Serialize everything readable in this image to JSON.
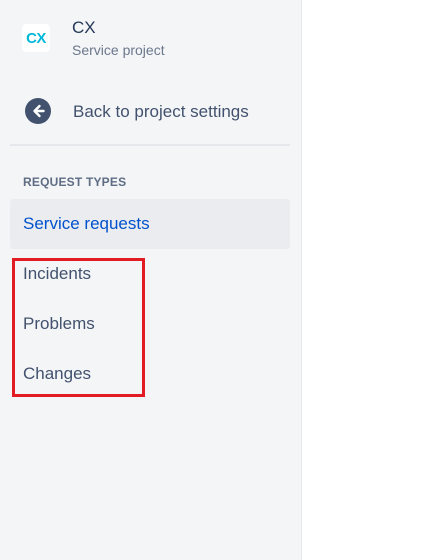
{
  "project": {
    "avatar_text": "CX",
    "name": "CX",
    "type": "Service project"
  },
  "navigation": {
    "back_label": "Back to project settings",
    "back_icon": "arrow-left-circle-icon"
  },
  "request_types": {
    "section_title": "REQUEST TYPES",
    "items": [
      {
        "label": "Service requests",
        "selected": true
      },
      {
        "label": "Incidents",
        "selected": false
      },
      {
        "label": "Problems",
        "selected": false
      },
      {
        "label": "Changes",
        "selected": false
      }
    ]
  },
  "colors": {
    "accent": "#0052cc",
    "avatar": "#00b8d9",
    "highlight": "#e31b23",
    "sidebar_bg": "#f4f5f7"
  }
}
